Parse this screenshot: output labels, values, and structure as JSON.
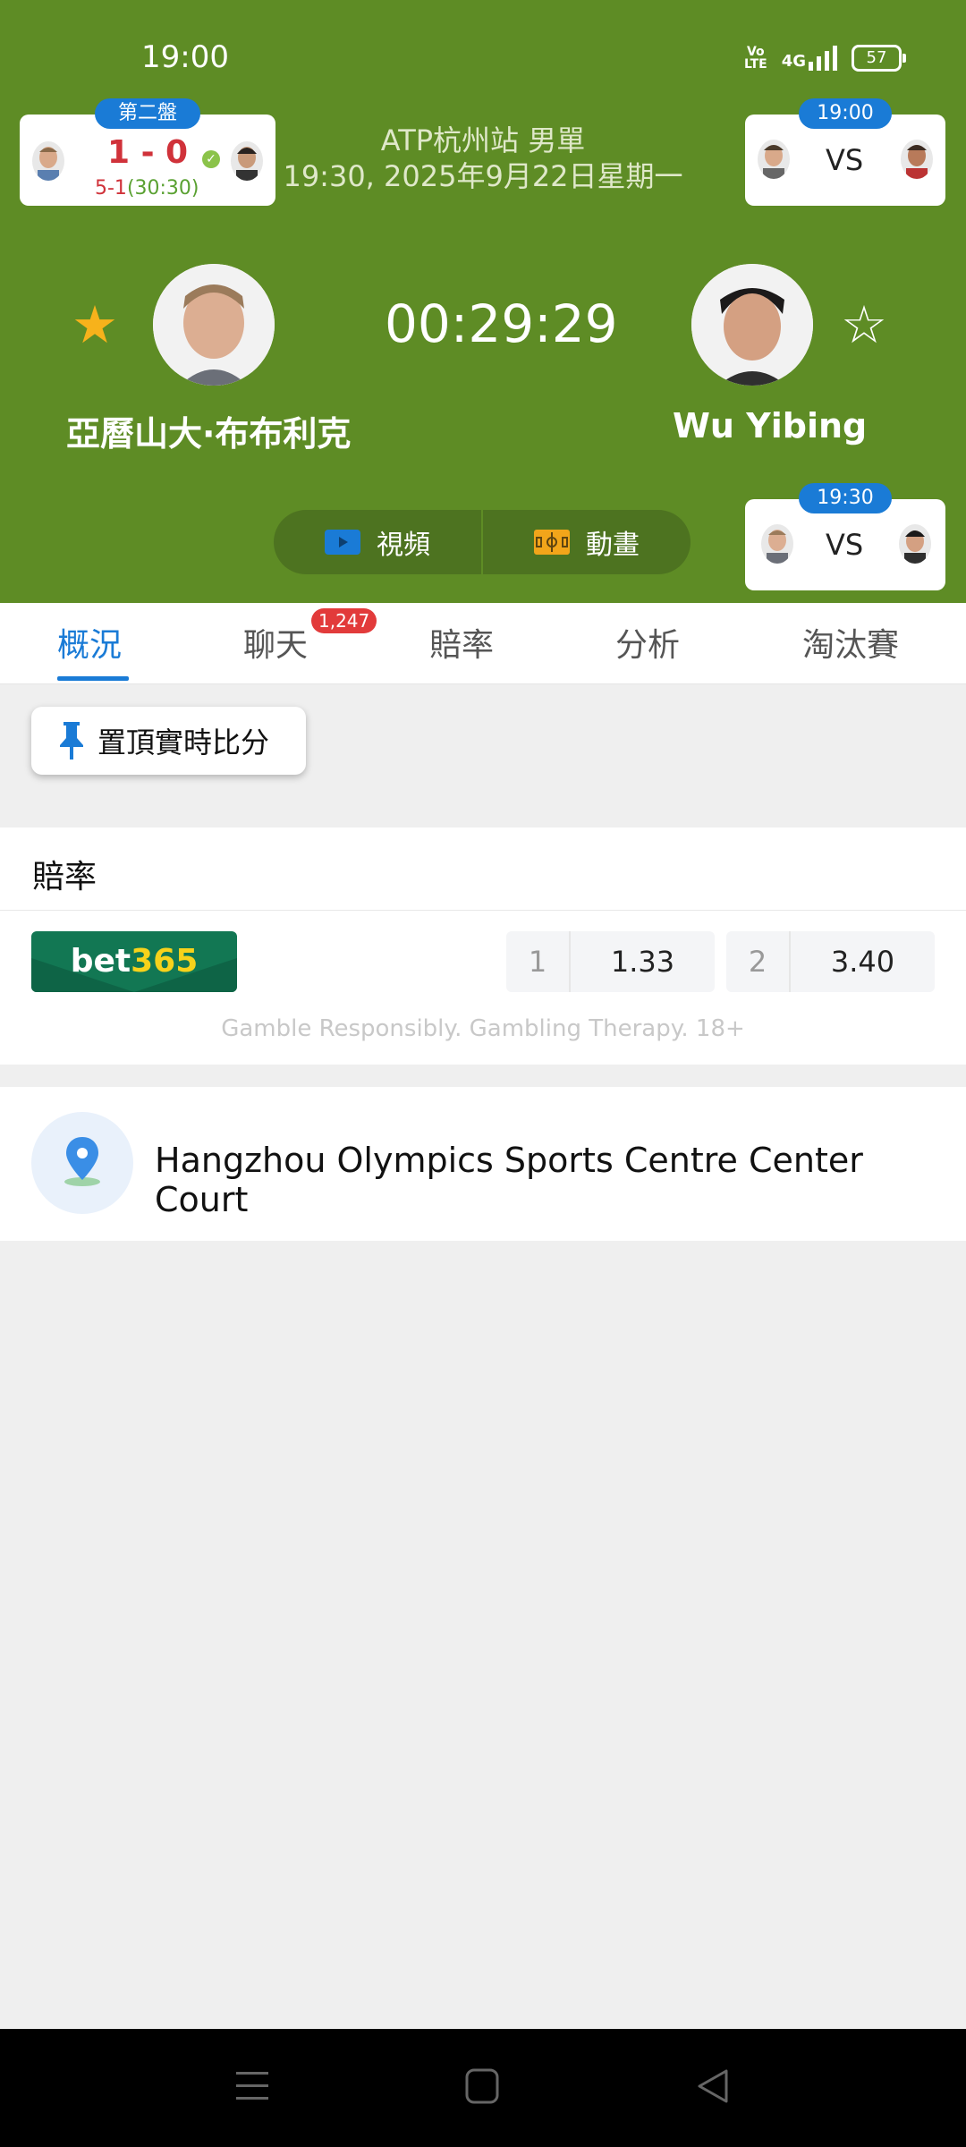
{
  "status": {
    "time": "19:00",
    "volte": "Vo\nLTE",
    "network": "4G",
    "battery": "57"
  },
  "header": {
    "competition": "ATP杭州站 男單",
    "datetime": "19:30, 2025年9月22日星期一",
    "timer": "00:29:29",
    "player1": {
      "name": "亞曆山大·布布利克",
      "favorite": true
    },
    "player2": {
      "name": "Wu Yibing",
      "favorite": false
    },
    "left_card": {
      "set_label": "第二盤",
      "score": "1 - 0",
      "game_score": "5-1",
      "point_score": "(30:30)"
    },
    "right_card_top": {
      "time": "19:00",
      "vs": "VS"
    },
    "right_card_bottom": {
      "time": "19:30",
      "vs": "VS"
    },
    "buttons": {
      "video": "視頻",
      "animation": "動畫"
    }
  },
  "tabs": [
    {
      "label": "概況",
      "active": true
    },
    {
      "label": "聊天",
      "badge": "1,247"
    },
    {
      "label": "賠率"
    },
    {
      "label": "分析"
    },
    {
      "label": "淘汰賽"
    }
  ],
  "pin_button": "置頂實時比分",
  "odds": {
    "title": "賠率",
    "bookmaker": {
      "prefix": "bet",
      "suffix": "365"
    },
    "entries": [
      {
        "key": "1",
        "value": "1.33"
      },
      {
        "key": "2",
        "value": "3.40"
      }
    ],
    "disclaimer": "Gamble Responsibly. Gambling Therapy. 18+"
  },
  "venue": {
    "name": "Hangzhou Olympics Sports Centre Center Court"
  },
  "colors": {
    "header_bg": "#5e8c25",
    "accent": "#1a7bd6",
    "score_red": "#d0323a",
    "badge_red": "#e23b3b",
    "star_gold": "#f7b21b"
  }
}
